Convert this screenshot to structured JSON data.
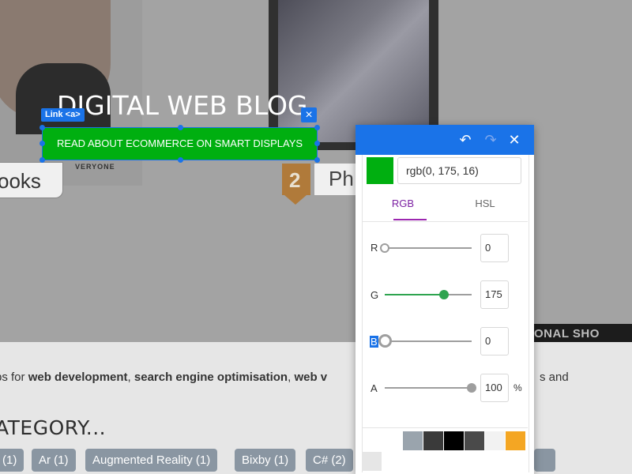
{
  "hero": {
    "title": "DIGITAL WEB BLOG",
    "cta_label": "READ ABOUT ECOMMERCE ON SMART DISPLAYS",
    "link_tag": "Link <a>",
    "close_glyph": "×",
    "books_fragment": "ooks",
    "everyone_fragment": "VERYONE",
    "badge_number": "2",
    "phone_fragment": "Ph",
    "dark_fragment": "ONAL SHO"
  },
  "intro": {
    "prefix": "ps for ",
    "bold1": "web development",
    "sep1": ", ",
    "bold2": "search engine optimisation",
    "sep2": ", ",
    "bold3": "web v",
    "suffix": "s and"
  },
  "category": {
    "heading": "ATEGORY...",
    "tags": [
      "(1)",
      "Ar (1)",
      "Augmented Reality (1)",
      "Bixby (1)",
      "C# (2)"
    ]
  },
  "picker": {
    "undo_icon": "↶",
    "redo_icon": "↷",
    "close_icon": "✕",
    "color_value": "rgb(0, 175, 16)",
    "tabs": [
      "RGB",
      "HSL"
    ],
    "active_tab": "RGB",
    "channels": [
      {
        "label": "R",
        "value": "0",
        "level": 0,
        "color": "#9e9e9e"
      },
      {
        "label": "G",
        "value": "175",
        "level": 0.686,
        "color": "#2ea44f"
      },
      {
        "label": "B",
        "value": "0",
        "level": 0,
        "color": "#9e9e9e"
      },
      {
        "label": "A",
        "value": "100",
        "level": 1,
        "color": "#9e9e9e"
      }
    ],
    "percent_sign": "%",
    "palette": [
      "#9aa4ad",
      "#3a3a3a",
      "#000000",
      "#4a4a4a",
      "#f2f2f2",
      "#f4a623",
      "#e6e6e6"
    ],
    "swatch_color": "#00af10"
  },
  "colors": {
    "accent": "#1a73e8",
    "cta": "#00af10",
    "tag_bg": "#8a96a2"
  }
}
